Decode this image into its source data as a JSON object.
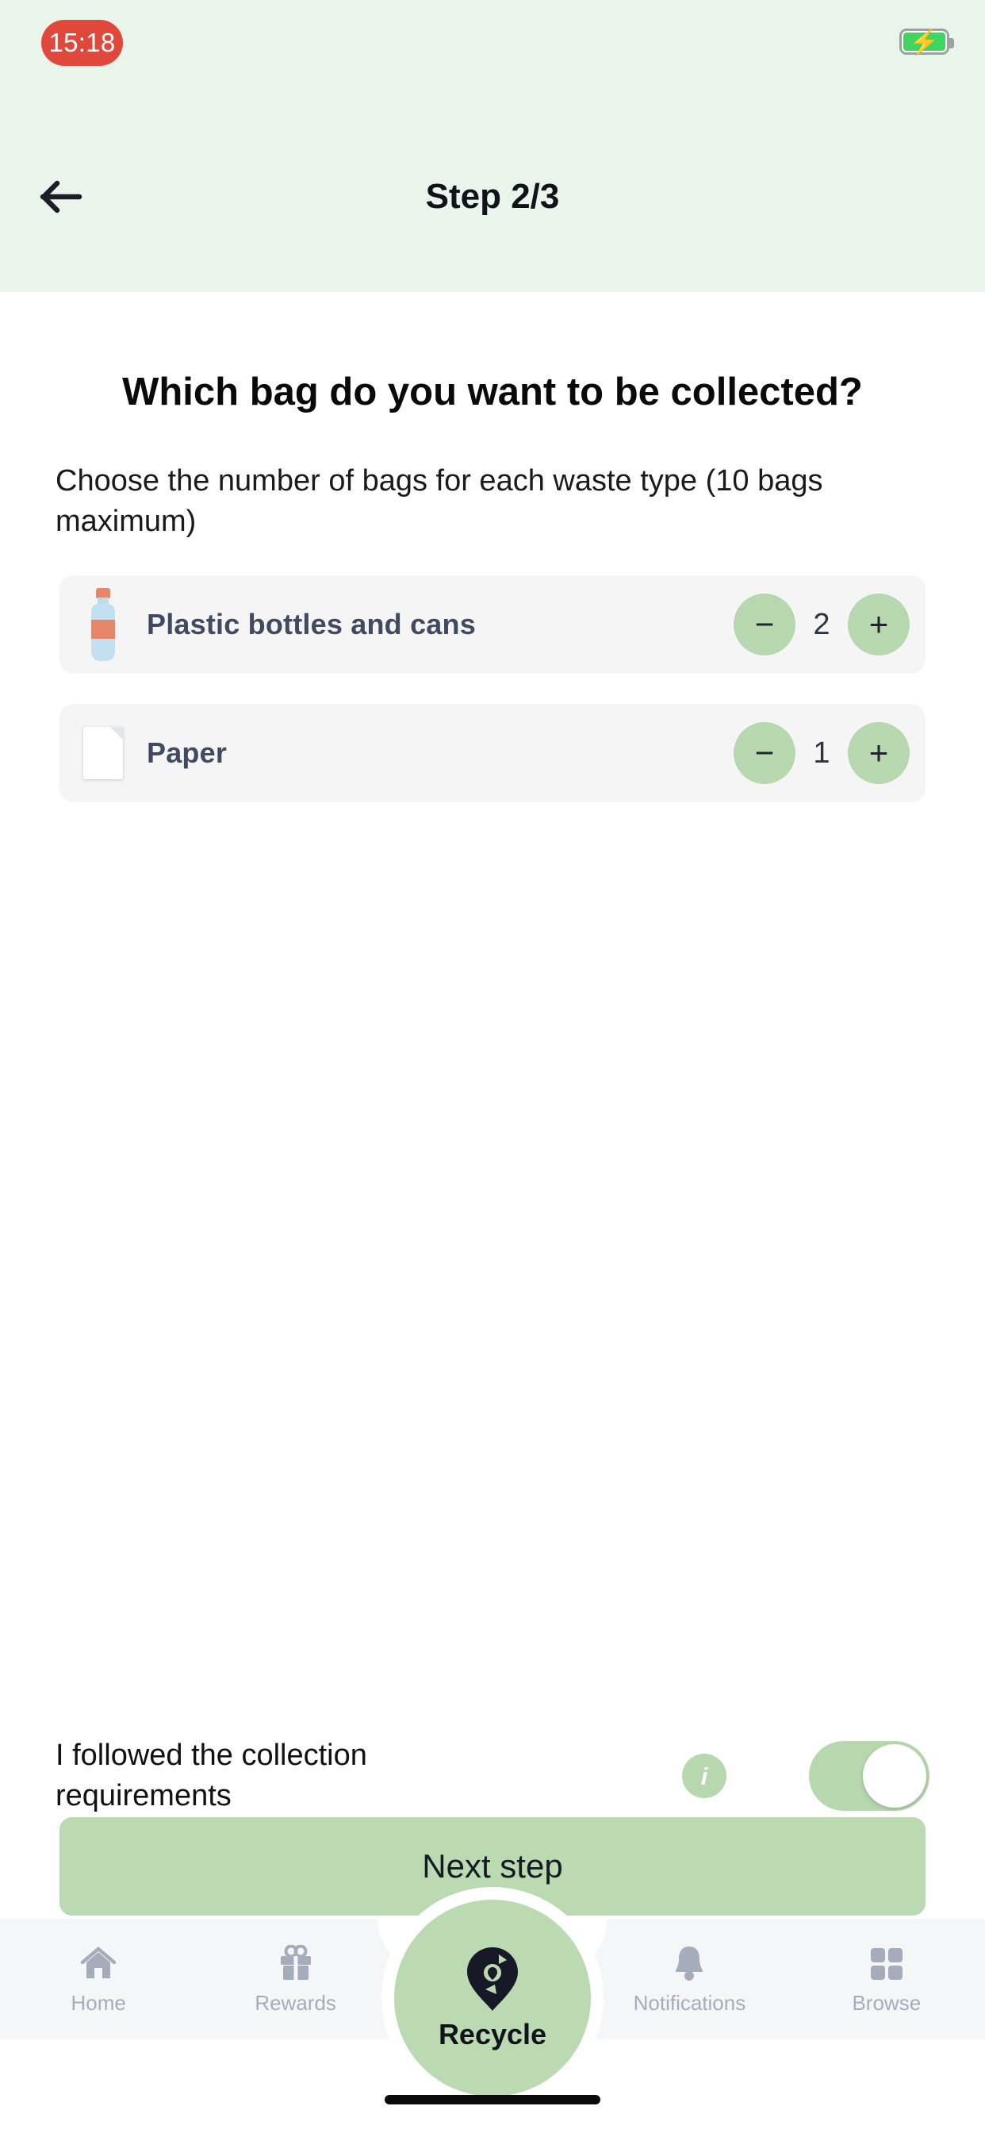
{
  "status_bar": {
    "recording_time": "15:18",
    "battery_state": "charging",
    "battery_icon": "battery-charging-icon",
    "signal_ghost": ""
  },
  "nav": {
    "back_icon": "back-arrow-icon",
    "title": "Step 2/3"
  },
  "main": {
    "heading": "Which bag do you want to be collected?",
    "subtext": "Choose the number of bags for each waste type (10 bags maximum)",
    "waste_items": [
      {
        "icon": "plastic-bottle-icon",
        "label": "Plastic bottles and cans",
        "count": "2",
        "decrement_label": "−",
        "increment_label": "+"
      },
      {
        "icon": "paper-sheet-icon",
        "label": "Paper",
        "count": "1",
        "decrement_label": "−",
        "increment_label": "+"
      }
    ]
  },
  "requirements": {
    "text": "I followed the collection requirements",
    "info_icon": "info-icon",
    "info_glyph": "i",
    "toggle_state": "on"
  },
  "primary_action": {
    "label": "Next step"
  },
  "tabbar": {
    "items": [
      {
        "icon": "home-icon",
        "label": "Home"
      },
      {
        "icon": "gift-icon",
        "label": "Rewards"
      },
      {
        "icon": "recycle-pin-icon",
        "label": "Recycle"
      },
      {
        "icon": "bell-icon",
        "label": "Notifications"
      },
      {
        "icon": "grid-icon",
        "label": "Browse"
      }
    ]
  },
  "colors": {
    "header_green": "#e9f4ea",
    "accent_green": "#b7d8ae",
    "button_green": "#bbdab1",
    "card_gray": "#f5f5f6",
    "label_slate": "#414a5e",
    "tab_gray": "#a6adba",
    "record_red": "#e0483c"
  }
}
